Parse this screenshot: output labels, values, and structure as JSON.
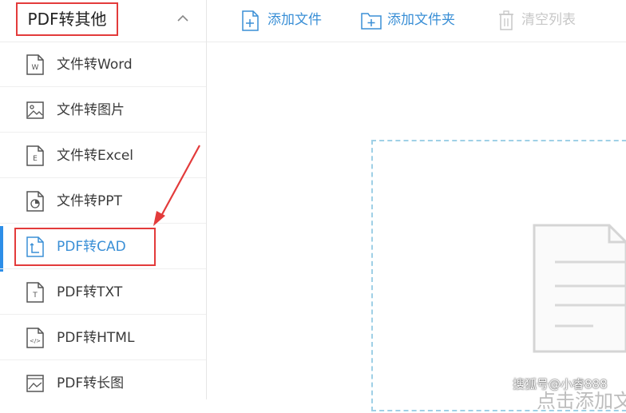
{
  "sidebar": {
    "header_title": "PDF转其他",
    "items": [
      {
        "label": "文件转Word",
        "icon": "word-file-icon"
      },
      {
        "label": "文件转图片",
        "icon": "image-file-icon"
      },
      {
        "label": "文件转Excel",
        "icon": "excel-file-icon"
      },
      {
        "label": "文件转PPT",
        "icon": "ppt-file-icon"
      },
      {
        "label": "PDF转CAD",
        "icon": "cad-file-icon",
        "active": true
      },
      {
        "label": "PDF转TXT",
        "icon": "txt-file-icon"
      },
      {
        "label": "PDF转HTML",
        "icon": "html-file-icon"
      },
      {
        "label": "PDF转长图",
        "icon": "long-image-file-icon"
      }
    ]
  },
  "toolbar": {
    "add_file": "添加文件",
    "add_folder": "添加文件夹",
    "clear_list": "清空列表"
  },
  "main": {
    "drop_text": "点击添加文"
  },
  "watermark": "搜狐号@小睿888",
  "colors": {
    "accent": "#3a8fd6",
    "highlight_red": "#e33b3b",
    "disabled": "#c7c7c7"
  }
}
